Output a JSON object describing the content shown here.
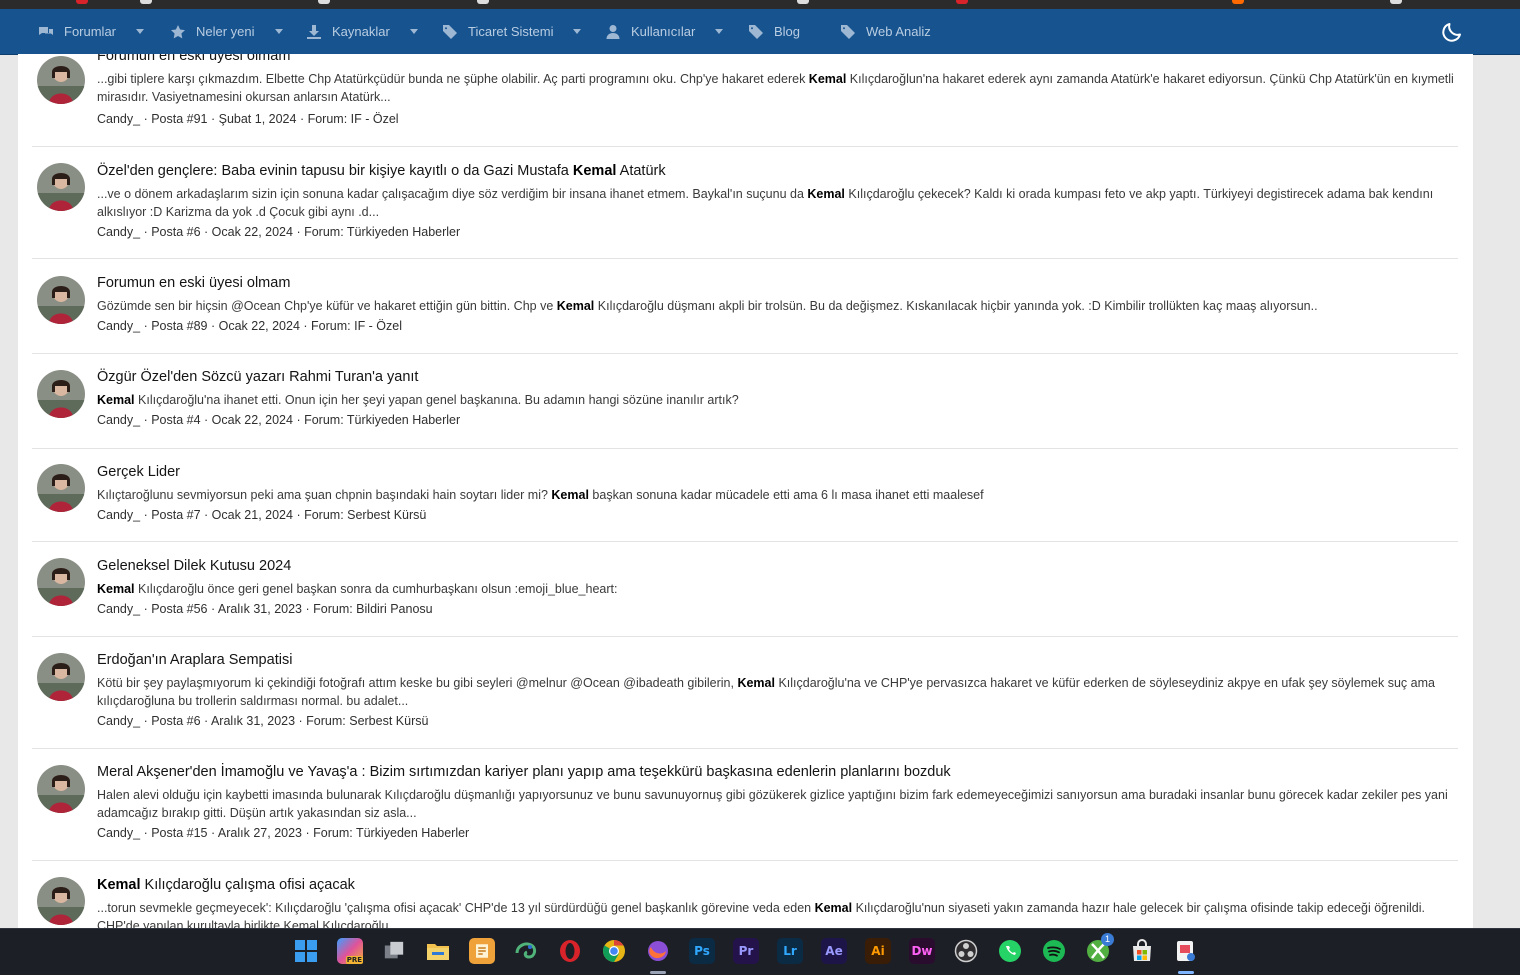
{
  "nav": {
    "items": [
      {
        "label": "Forumlar",
        "icon": "chat-bubbles-icon",
        "caret": true
      },
      {
        "label": "Neler yeni",
        "icon": "star-icon",
        "caret": true
      },
      {
        "label": "Kaynaklar",
        "icon": "download-icon",
        "caret": true
      },
      {
        "label": "Ticaret Sistemi",
        "icon": "tag-icon",
        "caret": true
      },
      {
        "label": "Kullanıcılar",
        "icon": "user-icon",
        "caret": true
      },
      {
        "label": "Blog",
        "icon": "tag-icon",
        "caret": false
      },
      {
        "label": "Web Analiz",
        "icon": "tag-icon",
        "caret": false
      }
    ],
    "theme_icon": "moon-icon"
  },
  "results": [
    {
      "title_pre": "Forumun en eski üyesi olmam",
      "title_bold": "",
      "title_post": "",
      "snippet_pre": "...gibi tiplere karşı çıkmazdım. Elbette Chp Atatürkçüdür bunda ne şüphe olabilir. Aç parti programını oku. Chp'ye hakaret ederek ",
      "snippet_bold": "Kemal",
      "snippet_post": " Kılıçdaroğlun'na hakaret ederek aynı zamanda Atatürk'e hakaret ediyorsun. Çünkü Chp Atatürk'ün en kıymetli mirasıdır. Vasiyetnamesini okursan anlarsın Atatürk...",
      "author": "Candy_",
      "post": "Posta #91",
      "date": "Şubat 1, 2024",
      "forum": "Forum: IF - Özel"
    },
    {
      "title_pre": "Özel'den gençlere: Baba evinin tapusu bir kişiye kayıtlı o da Gazi Mustafa ",
      "title_bold": "Kemal",
      "title_post": " Atatürk",
      "snippet_pre": "...ve o dönem arkadaşlarım sizin için sonuna kadar çalışacağım diye söz verdiğim bir insana ihanet etmem. Baykal'ın suçunu da ",
      "snippet_bold": "Kemal",
      "snippet_post": " Kılıçdaroğlu çekecek? Kaldı ki orada kumpası feto ve akp yaptı. Türkiyeyi degistirecek adama bak kendını alkıslıyor :D Karizma da yok .d Çocuk gibi aynı .d...",
      "author": "Candy_",
      "post": "Posta #6",
      "date": "Ocak 22, 2024",
      "forum": "Forum: Türkiyeden Haberler"
    },
    {
      "title_pre": "Forumun en eski üyesi olmam",
      "title_bold": "",
      "title_post": "",
      "snippet_pre": "Gözümde sen bir hiçsin @Ocean Chp'ye küfür ve hakaret ettiğin gün bittin. Chp ve ",
      "snippet_bold": "Kemal",
      "snippet_post": " Kılıçdaroğlu düşmanı akpli bir trolsün. Bu da değişmez. Kıskanılacak hiçbir yanında yok. :D Kimbilir trollükten kaç maaş alıyorsun..",
      "author": "Candy_",
      "post": "Posta #89",
      "date": "Ocak 22, 2024",
      "forum": "Forum: IF - Özel"
    },
    {
      "title_pre": "Özgür Özel'den Sözcü yazarı Rahmi Turan'a yanıt",
      "title_bold": "",
      "title_post": "",
      "snippet_pre": "",
      "snippet_bold": "Kemal",
      "snippet_post": " Kılıçdaroğlu'na ihanet etti. Onun için her şeyi yapan genel başkanına. Bu adamın hangi sözüne inanılır artık?",
      "author": "Candy_",
      "post": "Posta #4",
      "date": "Ocak 22, 2024",
      "forum": "Forum: Türkiyeden Haberler"
    },
    {
      "title_pre": "Gerçek Lider",
      "title_bold": "",
      "title_post": "",
      "snippet_pre": "Kılıçtaroğlunu sevmiyorsun peki ama şuan chpnin başındaki hain soytarı lider mi? ",
      "snippet_bold": "Kemal",
      "snippet_post": " başkan sonuna kadar mücadele etti ama 6 lı masa ihanet etti maalesef",
      "author": "Candy_",
      "post": "Posta #7",
      "date": "Ocak 21, 2024",
      "forum": "Forum: Serbest Kürsü"
    },
    {
      "title_pre": "Geleneksel Dilek Kutusu 2024",
      "title_bold": "",
      "title_post": "",
      "snippet_pre": "",
      "snippet_bold": "Kemal",
      "snippet_post": " Kılıçdaroğlu önce geri genel başkan sonra da cumhurbaşkanı olsun :emoji_blue_heart:",
      "author": "Candy_",
      "post": "Posta #56",
      "date": "Aralık 31, 2023",
      "forum": "Forum: Bildiri Panosu"
    },
    {
      "title_pre": "Erdoğan'ın Araplara Sempatisi",
      "title_bold": "",
      "title_post": "",
      "snippet_pre": "Kötü bir şey paylaşmıyorum ki çekindiği fotoğrafı attım keske bu gibi seyleri @melnur @Ocean @ibadeath gibilerin, ",
      "snippet_bold": "Kemal",
      "snippet_post": " Kılıçdaroğlu'na ve CHP'ye pervasızca hakaret ve küfür ederken de söyleseydiniz akpye en ufak şey söylemek suç ama kılıçdaroğluna bu trollerin saldırması normal. bu adalet...",
      "author": "Candy_",
      "post": "Posta #6",
      "date": "Aralık 31, 2023",
      "forum": "Forum: Serbest Kürsü"
    },
    {
      "title_pre": "Meral Akşener'den İmamoğlu ve Yavaş'a : Bizim sırtımızdan kariyer planı yapıp ama teşekkürü başkasına edenlerin planlarını bozduk",
      "title_bold": "",
      "title_post": "",
      "snippet_pre": "Halen alevi olduğu için kaybetti imasında bulunarak Kılıçdaroğlu düşmanlığı yapıyorsunuz ve bunu savunuyornuş gibi gözükerek gizlice yaptığını bizim fark edemeyeceğimizi sanıyorsun ama buradaki insanlar bunu görecek kadar zekiler pes yani adamcağız bırakıp gitti. Düşün artık yakasından siz asla...",
      "snippet_bold": "",
      "snippet_post": "",
      "author": "Candy_",
      "post": "Posta #15",
      "date": "Aralık 27, 2023",
      "forum": "Forum: Türkiyeden Haberler"
    },
    {
      "title_pre": "",
      "title_bold": "Kemal",
      "title_post": " Kılıçdaroğlu çalışma ofisi açacak",
      "snippet_pre": "...torun sevmekle geçmeyecek': Kılıçdaroğlu 'çalışma ofisi açacak' CHP'de 13 yıl sürdürdüğü genel başkanlık görevine veda eden ",
      "snippet_bold": "Kemal",
      "snippet_post": " Kılıçdaroğlu'nun siyaseti yakın zamanda hazır hale gelecek bir çalışma ofisinde takip edeceği öğrenildi. CHP'de yapılan kurultayla birlikte Kemal Kılıçdaroğlu...",
      "author": "",
      "post": "",
      "date": "",
      "forum": ""
    }
  ],
  "taskbar": {
    "icons": [
      {
        "name": "windows-start-icon",
        "label": "",
        "color": "#3a8ee6"
      },
      {
        "name": "copilot-icon",
        "label": "PRE",
        "color": "#c2539a"
      },
      {
        "name": "task-view-icon",
        "label": "",
        "color": "#8a8f98"
      },
      {
        "name": "file-explorer-icon",
        "label": "",
        "color": "#f2c14e"
      },
      {
        "name": "notepad-icon",
        "label": "",
        "color": "#f0a23a"
      },
      {
        "name": "chameleon-icon",
        "label": "",
        "color": "#4fb37a"
      },
      {
        "name": "opera-icon",
        "label": "O",
        "color": "#d8232a"
      },
      {
        "name": "chrome-icon",
        "label": "",
        "color": "#e7b416"
      },
      {
        "name": "firefox-icon",
        "label": "",
        "color": "#8a4fd6"
      },
      {
        "name": "photoshop-icon",
        "label": "Ps",
        "color": "#0b2a44"
      },
      {
        "name": "premiere-icon",
        "label": "Pr",
        "color": "#23134a"
      },
      {
        "name": "lightroom-icon",
        "label": "Lr",
        "color": "#0b2a44"
      },
      {
        "name": "after-effects-icon",
        "label": "Ae",
        "color": "#1d1548"
      },
      {
        "name": "illustrator-icon",
        "label": "Ai",
        "color": "#3a1d06"
      },
      {
        "name": "dreamweaver-icon",
        "label": "Dw",
        "color": "#2a0d2e"
      },
      {
        "name": "obs-icon",
        "label": "",
        "color": "#3b3b3b"
      },
      {
        "name": "whatsapp-icon",
        "label": "",
        "color": "#25d366"
      },
      {
        "name": "spotify-icon",
        "label": "",
        "color": "#1db954"
      },
      {
        "name": "xbox-icon",
        "label": "",
        "color": "#52b043"
      },
      {
        "name": "store-icon",
        "label": "",
        "color": "#3a7bd5"
      },
      {
        "name": "snipping-tool-icon",
        "label": "",
        "color": "#e54b5a"
      }
    ],
    "xbox_badge": "1"
  }
}
